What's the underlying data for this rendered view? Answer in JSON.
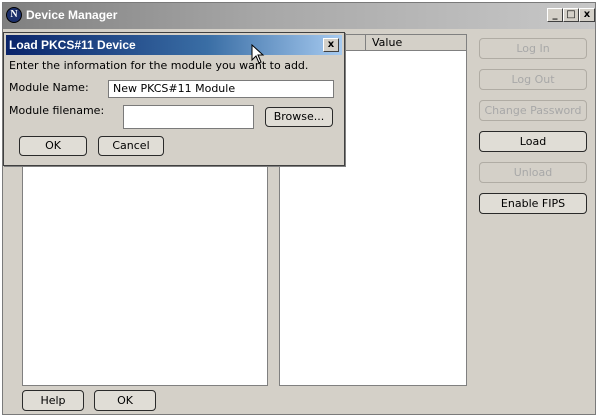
{
  "window": {
    "title": "Device Manager",
    "app_icon_glyph": "N",
    "controls": {
      "minimize": "_",
      "maximize": "□",
      "close": "x"
    }
  },
  "main": {
    "right_pane_header": "Value"
  },
  "side_buttons": {
    "log_in": "Log In",
    "log_out": "Log Out",
    "change_password": "Change Password",
    "load": "Load",
    "unload": "Unload",
    "enable_fips": "Enable FIPS"
  },
  "footer": {
    "help": "Help",
    "ok": "OK"
  },
  "dialog": {
    "title": "Load PKCS#11 Device",
    "close": "x",
    "instructions": "Enter the information for the module you want to add.",
    "module_name_label": "Module Name:",
    "module_name_value": "New PKCS#11 Module",
    "module_filename_label": "Module filename:",
    "module_filename_value": "",
    "browse": "Browse...",
    "ok": "OK",
    "cancel": "Cancel"
  },
  "icons": {
    "app": "netscape-n-icon",
    "cursor": "mouse-pointer-icon"
  },
  "colors": {
    "window_bg": "#d4d0c8",
    "active_title": "#0a246a",
    "inactive_title": "#a8a8a8",
    "disabled_text": "#a8a8a8"
  }
}
